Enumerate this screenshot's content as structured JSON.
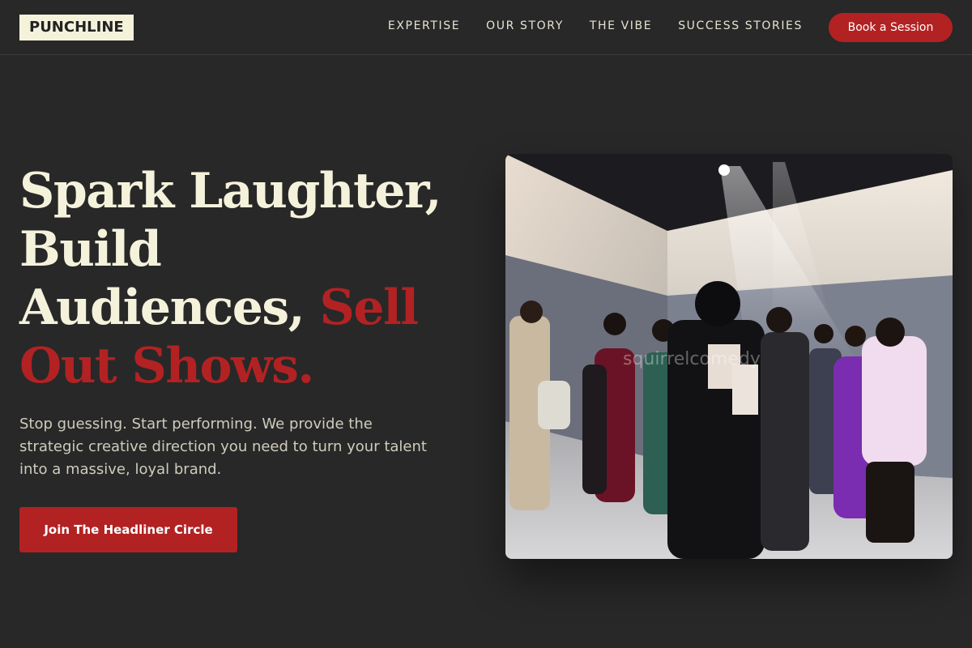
{
  "brand": {
    "logo_text": "PUNCHLINE"
  },
  "nav": {
    "links": [
      {
        "label": "EXPERTISE"
      },
      {
        "label": "OUR STORY"
      },
      {
        "label": "THE VIBE"
      },
      {
        "label": "SUCCESS STORIES"
      }
    ],
    "cta_label": "Book a Session"
  },
  "hero": {
    "title_line1": "Spark Laughter,",
    "title_line2": "Build",
    "title_line3_pre": "Audiences, ",
    "title_line3_accent": "Sell",
    "title_line4_accent": "Out Shows.",
    "subtitle": "Stop guessing. Start performing. We provide the strategic creative direction you need to turn your talent into a massive, loyal brand.",
    "cta_label": "Join The Headliner Circle",
    "photo_watermark": "squirrelcomedy"
  },
  "colors": {
    "background": "#282828",
    "accent": "#b22223",
    "cream": "#f5f2dc"
  }
}
